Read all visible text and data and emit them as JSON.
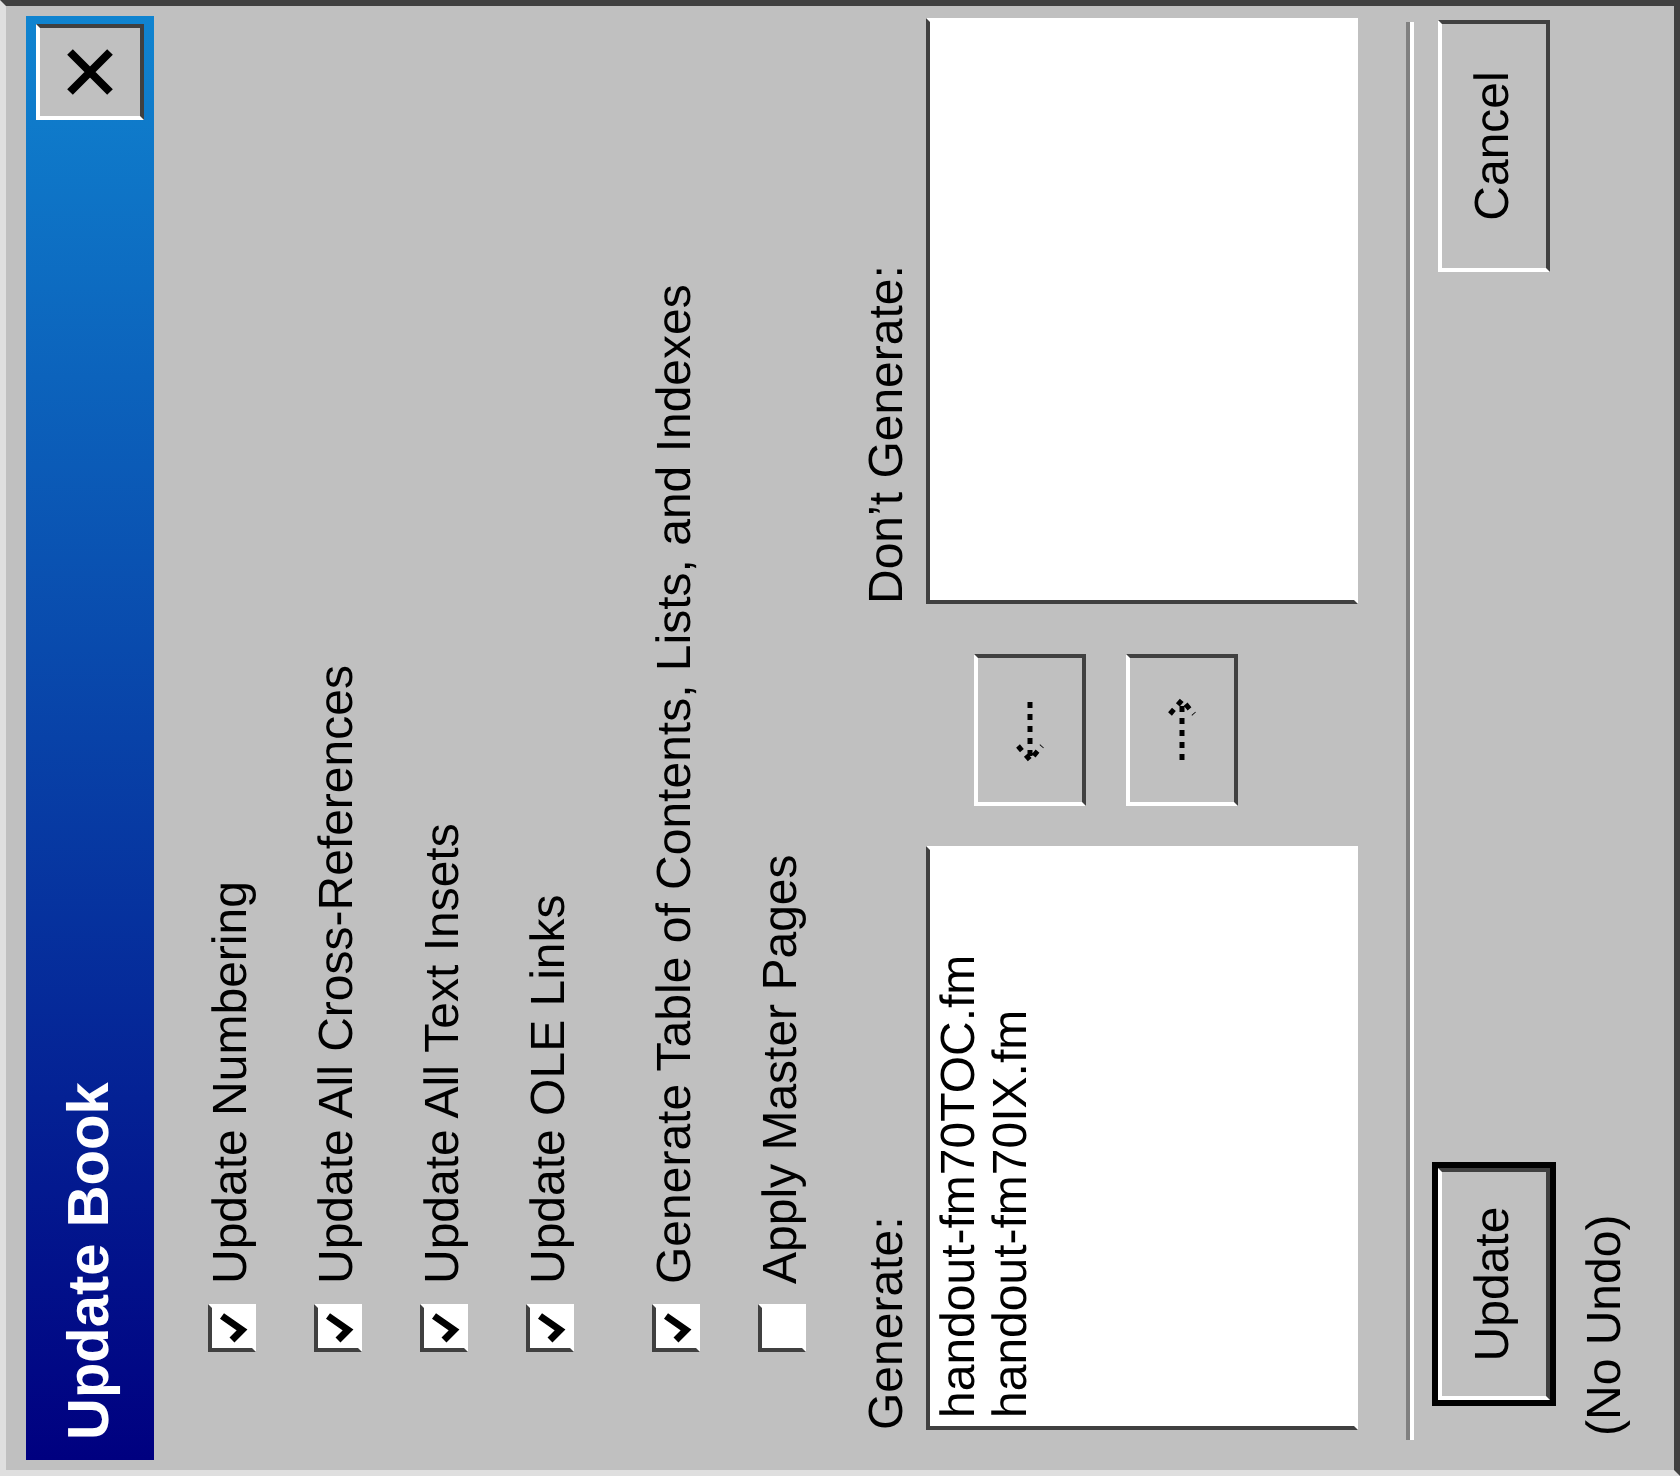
{
  "window": {
    "title": "Update Book"
  },
  "options": [
    {
      "label": "Update Numbering",
      "checked": true
    },
    {
      "label": "Update All Cross-References",
      "checked": true
    },
    {
      "label": "Update All Text Insets",
      "checked": true
    },
    {
      "label": "Update OLE Links",
      "checked": true
    },
    {
      "label": "Generate Table of Contents, Lists, and Indexes",
      "checked": true
    },
    {
      "label": "Apply Master Pages",
      "checked": false
    }
  ],
  "generate": {
    "label": "Generate:",
    "items": [
      "handout-fm70TOC.fm",
      "handout-fm70IX.fm"
    ]
  },
  "dont_generate": {
    "label": "Don’t Generate:"
  },
  "buttons": [
    {
      "label": "Update",
      "default": true
    },
    {
      "label": "Cancel",
      "default": false
    }
  ],
  "note": "(No Undo)"
}
